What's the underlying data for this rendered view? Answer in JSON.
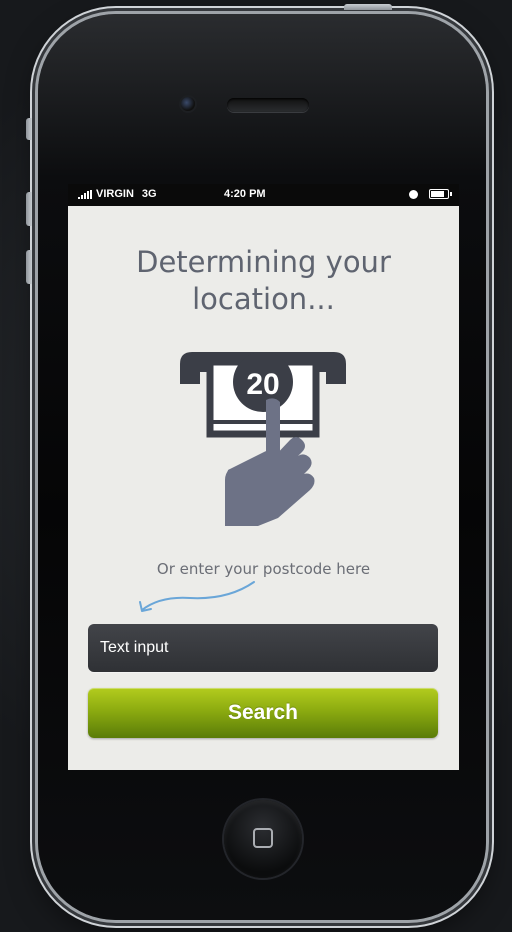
{
  "status_bar": {
    "carrier": "VIRGIN",
    "network": "3G",
    "time": "4:20 PM"
  },
  "main": {
    "headline_line1": "Determining your",
    "headline_line2": "location...",
    "illustration": {
      "icon": "hand-inserting-banknote-icon",
      "note_value": "20"
    },
    "hint": "Or enter your postcode here",
    "postcode_input": {
      "value": "Text input"
    },
    "search_button": {
      "label": "Search"
    }
  },
  "colors": {
    "accent_green": "#8cab10",
    "input_dark": "#3a3c40",
    "headline_gray": "#5f6470",
    "arrow_blue": "#6aa6d8",
    "illustration_slate": "#6d7286"
  }
}
